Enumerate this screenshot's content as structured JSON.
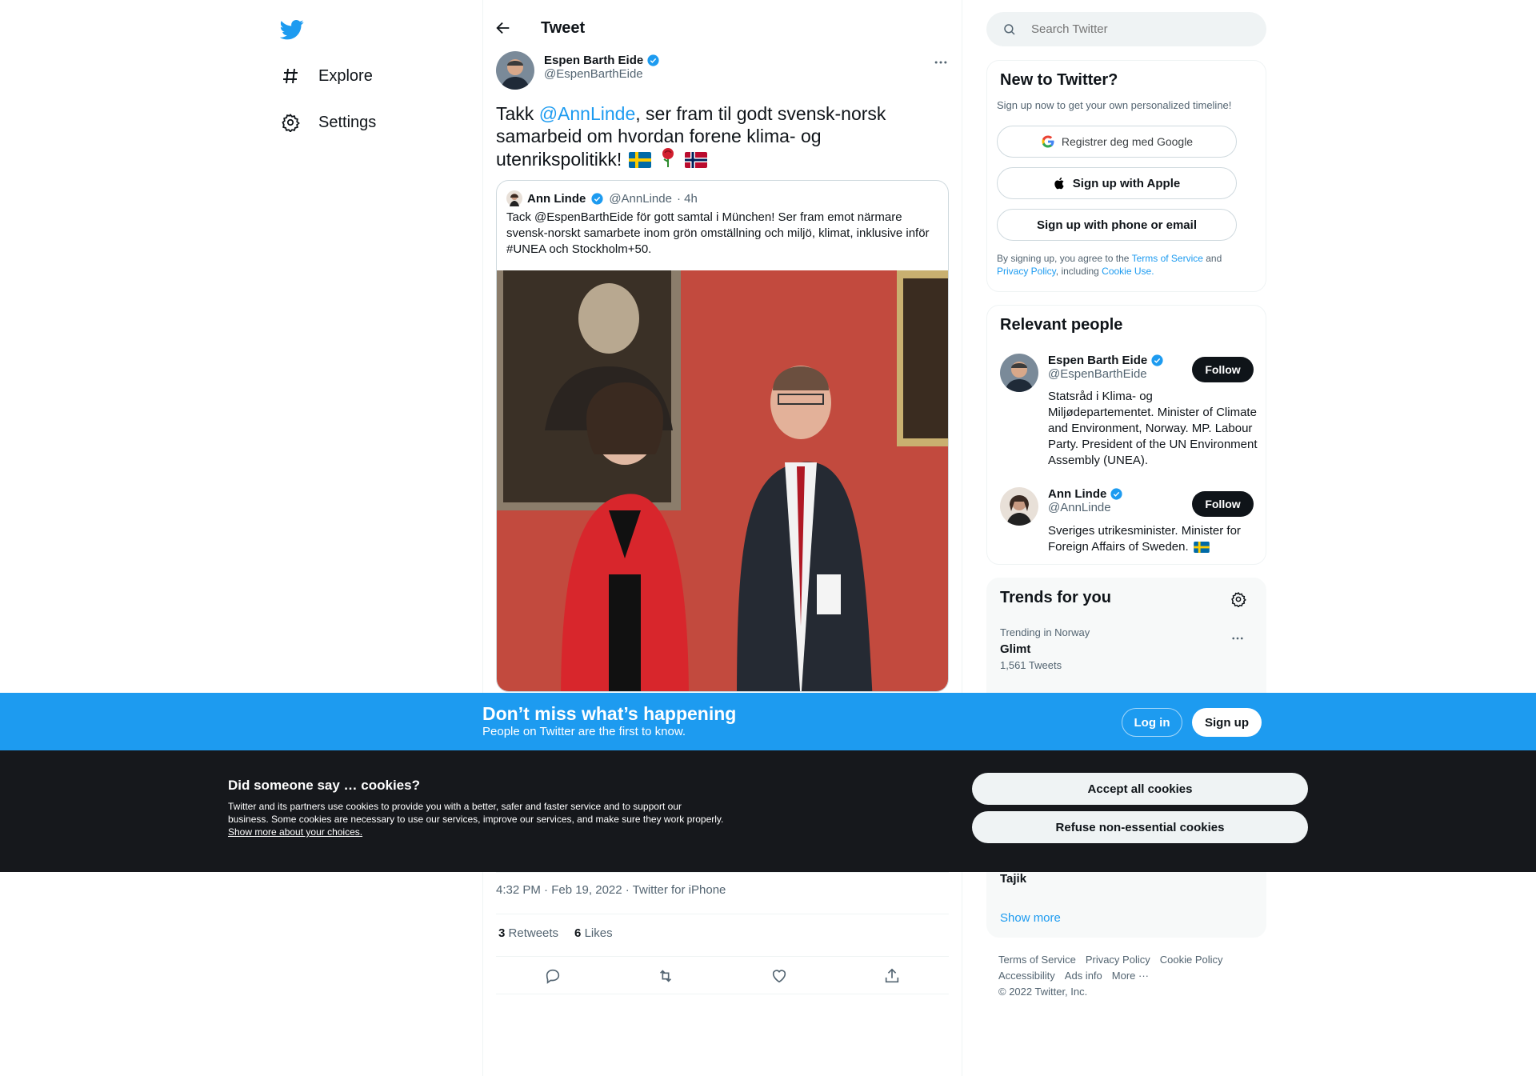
{
  "nav": {
    "items": [
      {
        "label": "Explore",
        "icon": "hashtag-icon"
      },
      {
        "label": "Settings",
        "icon": "gear-icon"
      }
    ]
  },
  "header": {
    "title": "Tweet"
  },
  "tweet": {
    "author_name": "Espen Barth Eide",
    "author_handle": "@EspenBarthEide",
    "text_prefix": "Takk ",
    "mention": "@AnnLinde",
    "text_suffix": ", ser fram til godt svensk-norsk samarbeid om hvordan forene klima- og utenrikspolitikk!",
    "emojis": [
      "swedish-flag",
      "rose",
      "norwegian-flag"
    ],
    "timestamp": "4:32 PM · Feb 19, 2022 · Twitter for iPhone",
    "retweets_count": "3",
    "retweets_label": "Retweets",
    "likes_count": "6",
    "likes_label": "Likes"
  },
  "quote": {
    "author_name": "Ann Linde",
    "author_handle": "@AnnLinde",
    "time": "· 4h",
    "text": "Tack @EspenBarthEide för gott samtal i München! Ser fram emot närmare svensk-norskt samarbete inom grön omställning och miljö, klimat, inklusive inför #UNEA och Stockholm+50."
  },
  "search": {
    "placeholder": "Search Twitter"
  },
  "signup_panel": {
    "title": "New to Twitter?",
    "subtitle": "Sign up now to get your own personalized timeline!",
    "google_label": "Registrer deg med Google",
    "apple_label": "Sign up with Apple",
    "phone_label": "Sign up with phone or email",
    "legal_prefix": "By signing up, you agree to the ",
    "terms_link": "Terms of Service",
    "and_text": " and ",
    "privacy_link": "Privacy Policy",
    "including_text": ", including ",
    "cookie_link": "Cookie Use."
  },
  "relevant_people": {
    "title": "Relevant people",
    "people": [
      {
        "name": "Espen Barth Eide",
        "handle": "@EspenBarthEide",
        "follow_label": "Follow",
        "bio": "Statsråd i Klima- og Miljødepartementet. Minister of Climate and Environment, Norway. MP. Labour Party. President of the UN Environment Assembly (UNEA)."
      },
      {
        "name": "Ann Linde",
        "handle": "@AnnLinde",
        "follow_label": "Follow",
        "bio": "Sveriges utrikesminister. Minister for Foreign Affairs of Sweden."
      }
    ]
  },
  "trends": {
    "title": "Trends for you",
    "items": [
      {
        "context": "Trending in Norway",
        "name": "Glimt",
        "count": "1,561 Tweets"
      },
      {
        "name": "Tajik"
      }
    ],
    "show_more": "Show more"
  },
  "footer": {
    "links": [
      "Terms of Service",
      "Privacy Policy",
      "Cookie Policy",
      "Accessibility",
      "Ads info",
      "More ···"
    ],
    "copyright": "© 2022 Twitter, Inc."
  },
  "banner": {
    "title": "Don’t miss what’s happening",
    "subtitle": "People on Twitter are the first to know.",
    "login_label": "Log in",
    "signup_label": "Sign up"
  },
  "cookies": {
    "title": "Did someone say … cookies?",
    "text": "Twitter and its partners use cookies to provide you with a better, safer and faster service and to support our business. Some cookies are necessary to use our services, improve our services, and make sure they work properly.",
    "link": "Show more about your choices.",
    "accept_label": "Accept all cookies",
    "refuse_label": "Refuse non-essential cookies"
  },
  "colors": {
    "accent": "#1d9bf0",
    "text": "#0f1419",
    "muted": "#536471",
    "cookie_bg": "#16181c"
  }
}
